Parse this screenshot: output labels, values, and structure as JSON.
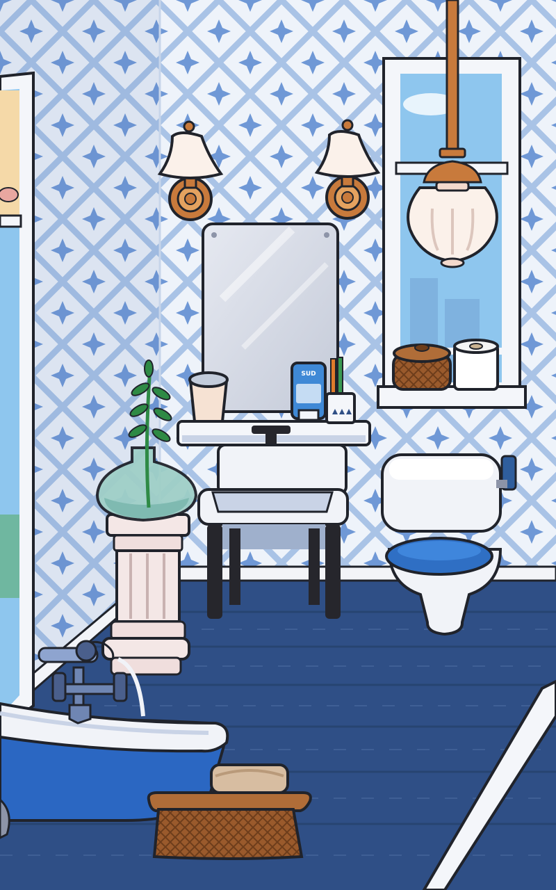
{
  "scene": {
    "toothpaste_brand": "SUD"
  },
  "colors": {
    "wallpaper_bg": "#eef3fa",
    "wallpaper_pattern": "#a9c3e6",
    "wallpaper_star": "#6f98d6",
    "floor": "#2f4f86",
    "floor_dark": "#27436f",
    "baseboard": "#f3f4f8",
    "outline": "#20232b",
    "brass": "#c87a3c",
    "brass_light": "#e4a25f",
    "porcelain": "#f1f3f8",
    "porcelain_shadow": "#c9d3e6",
    "toilet_seat": "#2f6fc4",
    "bathtub_blue": "#2b67c2",
    "wicker": "#9a5a2c",
    "wicker_dark": "#6d3d1b",
    "glass_vase": "#9fcfc7",
    "plant": "#2e8a45",
    "sky": "#8ec6ee",
    "mirror": "#d7dbe6"
  }
}
